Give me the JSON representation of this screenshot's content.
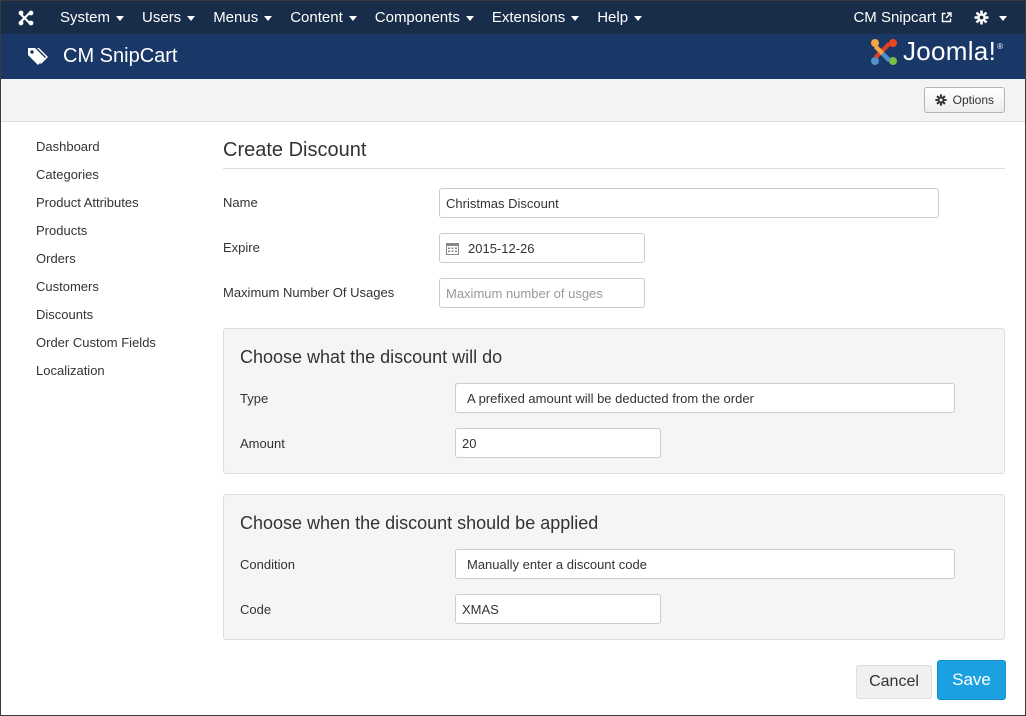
{
  "navbar": {
    "menu": [
      {
        "label": "System"
      },
      {
        "label": "Users"
      },
      {
        "label": "Menus"
      },
      {
        "label": "Content"
      },
      {
        "label": "Components"
      },
      {
        "label": "Extensions"
      },
      {
        "label": "Help"
      }
    ],
    "site_name": "CM Snipcart",
    "bg_color": "#182d49"
  },
  "header": {
    "title": "CM SnipCart",
    "brand": "Joomla!",
    "bg_color": "#1a3867"
  },
  "toolbar": {
    "options_label": "Options"
  },
  "sidebar": {
    "items": [
      {
        "label": "Dashboard"
      },
      {
        "label": "Categories"
      },
      {
        "label": "Product Attributes"
      },
      {
        "label": "Products"
      },
      {
        "label": "Orders"
      },
      {
        "label": "Customers"
      },
      {
        "label": "Discounts"
      },
      {
        "label": "Order Custom Fields"
      },
      {
        "label": "Localization"
      }
    ]
  },
  "form": {
    "title": "Create Discount",
    "name": {
      "label": "Name",
      "value": "Christmas Discount"
    },
    "expire": {
      "label": "Expire",
      "value": "2015-12-26"
    },
    "max_usages": {
      "label": "Maximum Number Of Usages",
      "value": "",
      "placeholder": "Maximum number of usges"
    },
    "what_section": {
      "title": "Choose what the discount will do",
      "type": {
        "label": "Type",
        "value": "A prefixed amount will be deducted from the order"
      },
      "amount": {
        "label": "Amount",
        "value": "20"
      }
    },
    "when_section": {
      "title": "Choose when the discount should be applied",
      "condition": {
        "label": "Condition",
        "value": "Manually enter a discount code"
      },
      "code": {
        "label": "Code",
        "value": "XMAS"
      }
    }
  },
  "actions": {
    "cancel_label": "Cancel",
    "save_label": "Save",
    "save_color": "#1ba0e1"
  }
}
